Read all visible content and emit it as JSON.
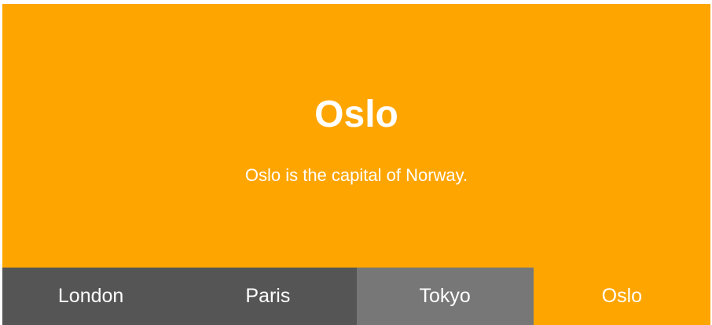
{
  "active_tab": "Oslo",
  "panel": {
    "title": "Oslo",
    "text": "Oslo is the capital of Norway.",
    "color": "#FFA500"
  },
  "tabs": [
    {
      "label": "London",
      "color": "#555555",
      "state": "default"
    },
    {
      "label": "Paris",
      "color": "#555555",
      "state": "default"
    },
    {
      "label": "Tokyo",
      "color": "#777777",
      "state": "hover"
    },
    {
      "label": "Oslo",
      "color": "#FFA500",
      "state": "active"
    }
  ]
}
